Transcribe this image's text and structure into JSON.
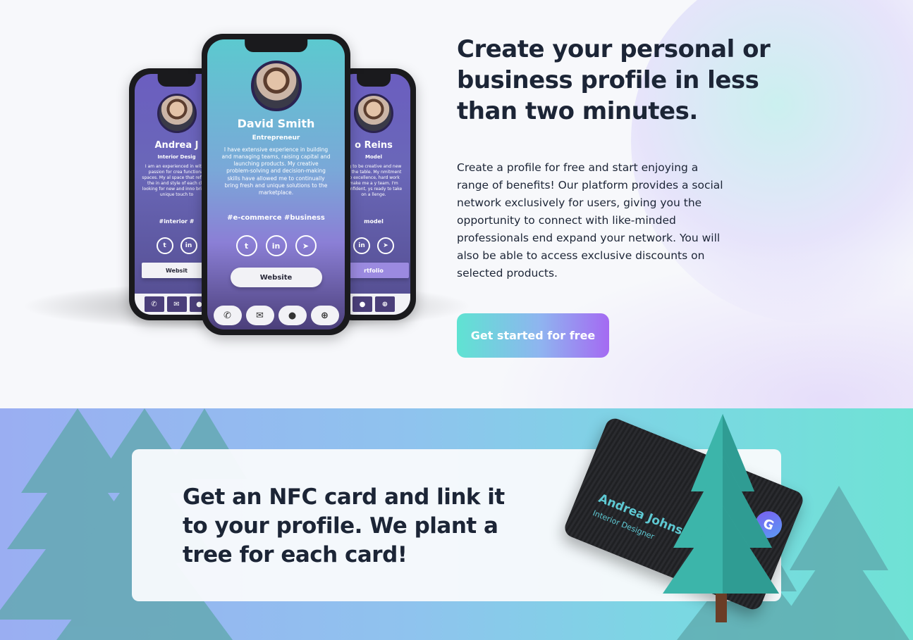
{
  "hero": {
    "title": "Create your personal or business profile in less than two minutes.",
    "description": "Create a profile for free and start enjoying a range of benefits! Our platform provides a social network exclusively for users, giving you the opportunity to connect with like-minded professionals end expand your network. You will also be able to access exclusive discounts on selected products.",
    "cta_label": "Get started for free"
  },
  "phones": {
    "center": {
      "name": "David Smith",
      "role": "Entrepreneur",
      "bio": "I have extensive experience in building and managing teams, raising capital and launching products. My creative problem-solving and decision-making skills have allowed me to continually bring fresh and unique solutions to the marketplace.",
      "tags": "#e-commerce   #business",
      "socials": [
        "twitter-icon",
        "linkedin-icon",
        "telegram-icon"
      ],
      "website_label": "Website",
      "dock": [
        "phone-icon",
        "mail-icon",
        "location-icon",
        "globe-icon"
      ]
    },
    "left": {
      "name": "Andrea J",
      "role": "Interior Desig",
      "bio": "I am an experienced in with a passion for crea functional spaces. My al space that reflects the in and style of each clie looking for new and inno bring a unique touch to",
      "tags": "#interior   #",
      "website_label": "Websit"
    },
    "right": {
      "name": "o Reins",
      "role": "Model",
      "bio": "ng to be creative and new to the table. My nmitment to excellence, hard work make me a y team. I'm confident, ys ready to take on a llenge.",
      "tags": "model",
      "website_label": "rtfolio"
    }
  },
  "nfc": {
    "title": "Get an NFC card and link it to your profile. We plant a tree for each card!",
    "card_name": "Andrea Johns",
    "card_role": "Interior Designer",
    "card_logo": "G"
  },
  "colors": {
    "heading": "#1c2536",
    "cta_start": "#5fe3d2",
    "cta_end": "#a46af2",
    "tree": "#3aa8a0"
  }
}
